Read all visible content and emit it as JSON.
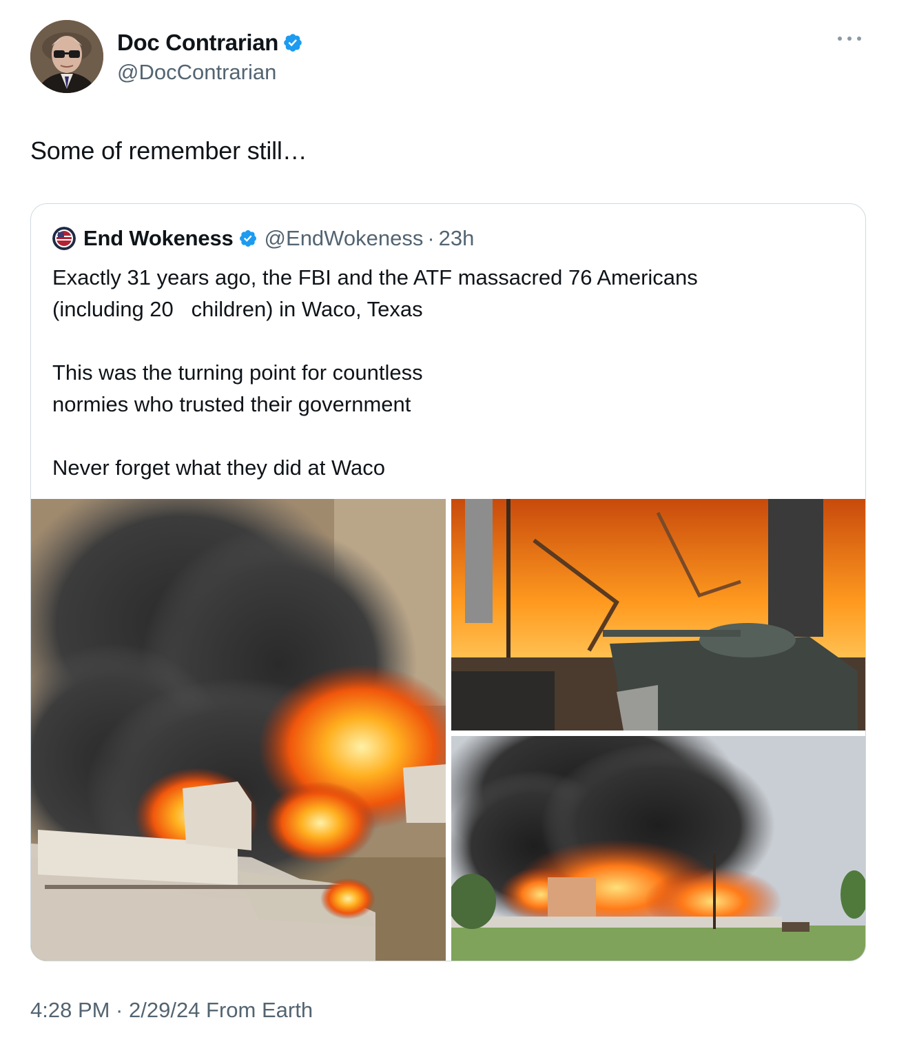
{
  "tweet": {
    "author": {
      "name": "Doc Contrarian",
      "handle": "@DocContrarian",
      "verified": true
    },
    "more_icon": "more-horizontal-icon",
    "text": "Some of remember still…",
    "timestamp": "4:28 PM · 2/29/24 From Earth"
  },
  "quoted_tweet": {
    "author": {
      "name": "End Wokeness",
      "handle": "@EndWokeness",
      "verified": true
    },
    "separator": "·",
    "time": "23h",
    "paragraphs": [
      "Exactly 31 years ago, the FBI and the ATF massacred 76 Americans\n(including 20   children) in Waco, Texas",
      "This was the turning point for countless\nnormies who trusted their government",
      "Never forget what they did at Waco"
    ]
  },
  "colors": {
    "text_primary": "#0f1419",
    "text_secondary": "#536471",
    "verified_blue": "#1d9bf0",
    "border": "#cfd9de"
  }
}
